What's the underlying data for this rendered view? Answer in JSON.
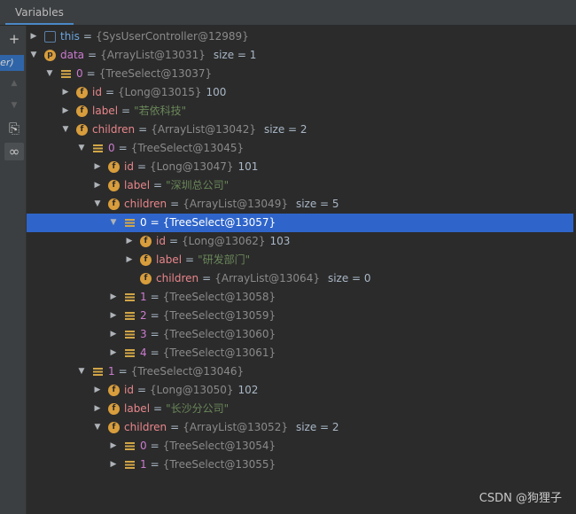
{
  "panel": {
    "tab_label": "Variables",
    "frame_label": "ller)"
  },
  "toolbar": {
    "add": "+",
    "up": "▲",
    "down": "▼",
    "copy": "⎘",
    "watch": "∞"
  },
  "tree": {
    "rows": [
      {
        "depth": 0,
        "expand": "collapsed",
        "icon": "object",
        "name": "this",
        "name_style": "this",
        "eq": "=",
        "ref": "{SysUserController@12989}",
        "value": "",
        "value_type": "",
        "extra": ""
      },
      {
        "depth": 0,
        "expand": "expanded",
        "icon": "param",
        "name": "data",
        "name_style": "var",
        "eq": "=",
        "ref": "{ArrayList@13031}",
        "value": "",
        "value_type": "",
        "extra": "size = 1"
      },
      {
        "depth": 1,
        "expand": "expanded",
        "icon": "list",
        "name": "0",
        "name_style": "var",
        "eq": "=",
        "ref": "{TreeSelect@13037}",
        "value": "",
        "value_type": "",
        "extra": ""
      },
      {
        "depth": 2,
        "expand": "collapsed",
        "icon": "field",
        "name": "id",
        "name_style": "field",
        "eq": "=",
        "ref": "{Long@13015}",
        "value": "100",
        "value_type": "num",
        "extra": ""
      },
      {
        "depth": 2,
        "expand": "collapsed",
        "icon": "field",
        "name": "label",
        "name_style": "field",
        "eq": "=",
        "ref": "",
        "value": "\"若依科技\"",
        "value_type": "str",
        "extra": ""
      },
      {
        "depth": 2,
        "expand": "expanded",
        "icon": "field",
        "name": "children",
        "name_style": "field",
        "eq": "=",
        "ref": "{ArrayList@13042}",
        "value": "",
        "value_type": "",
        "extra": "size = 2"
      },
      {
        "depth": 3,
        "expand": "expanded",
        "icon": "list",
        "name": "0",
        "name_style": "var",
        "eq": "=",
        "ref": "{TreeSelect@13045}",
        "value": "",
        "value_type": "",
        "extra": ""
      },
      {
        "depth": 4,
        "expand": "collapsed",
        "icon": "field",
        "name": "id",
        "name_style": "field",
        "eq": "=",
        "ref": "{Long@13047}",
        "value": "101",
        "value_type": "num",
        "extra": ""
      },
      {
        "depth": 4,
        "expand": "collapsed",
        "icon": "field",
        "name": "label",
        "name_style": "field",
        "eq": "=",
        "ref": "",
        "value": "\"深圳总公司\"",
        "value_type": "str",
        "extra": ""
      },
      {
        "depth": 4,
        "expand": "expanded",
        "icon": "field",
        "name": "children",
        "name_style": "field",
        "eq": "=",
        "ref": "{ArrayList@13049}",
        "value": "",
        "value_type": "",
        "extra": "size = 5"
      },
      {
        "depth": 5,
        "expand": "expanded",
        "icon": "list",
        "name": "0",
        "name_style": "var",
        "eq": "=",
        "ref": "{TreeSelect@13057}",
        "value": "",
        "value_type": "",
        "extra": "",
        "selected": true
      },
      {
        "depth": 6,
        "expand": "collapsed",
        "icon": "field",
        "name": "id",
        "name_style": "field",
        "eq": "=",
        "ref": "{Long@13062}",
        "value": "103",
        "value_type": "num",
        "extra": ""
      },
      {
        "depth": 6,
        "expand": "collapsed",
        "icon": "field",
        "name": "label",
        "name_style": "field",
        "eq": "=",
        "ref": "",
        "value": "\"研发部门\"",
        "value_type": "str",
        "extra": ""
      },
      {
        "depth": 6,
        "expand": "none",
        "icon": "field",
        "name": "children",
        "name_style": "field",
        "eq": "=",
        "ref": "{ArrayList@13064}",
        "value": "",
        "value_type": "",
        "extra": "size = 0"
      },
      {
        "depth": 5,
        "expand": "collapsed",
        "icon": "list",
        "name": "1",
        "name_style": "var",
        "eq": "=",
        "ref": "{TreeSelect@13058}",
        "value": "",
        "value_type": "",
        "extra": ""
      },
      {
        "depth": 5,
        "expand": "collapsed",
        "icon": "list",
        "name": "2",
        "name_style": "var",
        "eq": "=",
        "ref": "{TreeSelect@13059}",
        "value": "",
        "value_type": "",
        "extra": ""
      },
      {
        "depth": 5,
        "expand": "collapsed",
        "icon": "list",
        "name": "3",
        "name_style": "var",
        "eq": "=",
        "ref": "{TreeSelect@13060}",
        "value": "",
        "value_type": "",
        "extra": ""
      },
      {
        "depth": 5,
        "expand": "collapsed",
        "icon": "list",
        "name": "4",
        "name_style": "var",
        "eq": "=",
        "ref": "{TreeSelect@13061}",
        "value": "",
        "value_type": "",
        "extra": ""
      },
      {
        "depth": 3,
        "expand": "expanded",
        "icon": "list",
        "name": "1",
        "name_style": "var",
        "eq": "=",
        "ref": "{TreeSelect@13046}",
        "value": "",
        "value_type": "",
        "extra": ""
      },
      {
        "depth": 4,
        "expand": "collapsed",
        "icon": "field",
        "name": "id",
        "name_style": "field",
        "eq": "=",
        "ref": "{Long@13050}",
        "value": "102",
        "value_type": "num",
        "extra": ""
      },
      {
        "depth": 4,
        "expand": "collapsed",
        "icon": "field",
        "name": "label",
        "name_style": "field",
        "eq": "=",
        "ref": "",
        "value": "\"长沙分公司\"",
        "value_type": "str",
        "extra": ""
      },
      {
        "depth": 4,
        "expand": "expanded",
        "icon": "field",
        "name": "children",
        "name_style": "field",
        "eq": "=",
        "ref": "{ArrayList@13052}",
        "value": "",
        "value_type": "",
        "extra": "size = 2"
      },
      {
        "depth": 5,
        "expand": "collapsed",
        "icon": "list",
        "name": "0",
        "name_style": "var",
        "eq": "=",
        "ref": "{TreeSelect@13054}",
        "value": "",
        "value_type": "",
        "extra": ""
      },
      {
        "depth": 5,
        "expand": "collapsed",
        "icon": "list",
        "name": "1",
        "name_style": "var",
        "eq": "=",
        "ref": "{TreeSelect@13055}",
        "value": "",
        "value_type": "",
        "extra": ""
      }
    ]
  },
  "watermark": "CSDN @狗狸子",
  "colors": {
    "background": "#2b2b2b",
    "selection": "#2f65ca",
    "field_badge": "#d89d3c",
    "string_value": "#6a8759",
    "field_name": "#e8868b",
    "var_name": "#cc7bcf"
  }
}
